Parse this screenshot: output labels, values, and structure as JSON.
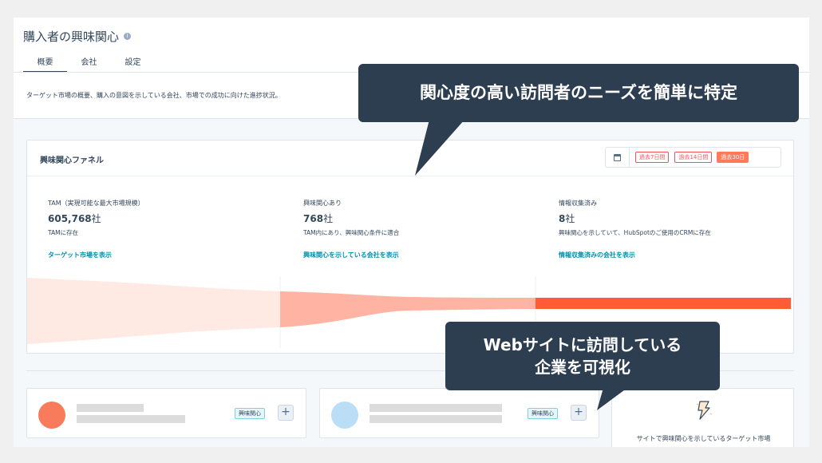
{
  "header": {
    "title": "購入者の興味関心",
    "tabs": [
      "概要",
      "会社",
      "設定"
    ],
    "description": "ターゲット市場の概要、購入の意図を示している会社、市場での成功に向けた進捗状況。"
  },
  "funnel": {
    "title": "興味関心ファネル",
    "ranges": [
      "過去7日間",
      "過去14日間",
      "過去30日"
    ],
    "selected_range": "過去30日",
    "stages": [
      {
        "label": "TAM（実現可能な最大市場規模）",
        "value": "605,768",
        "unit": "社",
        "sub": "TAMに存在",
        "link": "ターゲット市場を表示"
      },
      {
        "label": "興味関心あり",
        "value": "768",
        "unit": "社",
        "sub": "TAM内にあり、興味関心条件に適合",
        "link": "興味関心を示している会社を表示"
      },
      {
        "label": "情報収集済み",
        "value": "8",
        "unit": "社",
        "sub": "興味関心を示していて、HubSpotのご使用のCRMに存在",
        "link": "情報収集済みの会社を表示"
      }
    ],
    "colors": {
      "stage1": "#ffe9e3",
      "stage2": "#ffb4a3",
      "stage3": "#ff5c35"
    }
  },
  "companies": [
    {
      "avatar_color": "#f87c5b",
      "tag": "興味関心",
      "add": "+"
    },
    {
      "avatar_color": "#b9def5",
      "tag": "興味関心",
      "add": "+"
    }
  ],
  "insight": {
    "text": "サイトで興味関心を示しているターゲット市場",
    "icon": "lightning-bolt-icon"
  },
  "callouts": {
    "top": "関心度の高い訪問者のニーズを簡単に特定",
    "bottom_line1": "Webサイトに訪問している",
    "bottom_line2": "企業を可視化"
  }
}
